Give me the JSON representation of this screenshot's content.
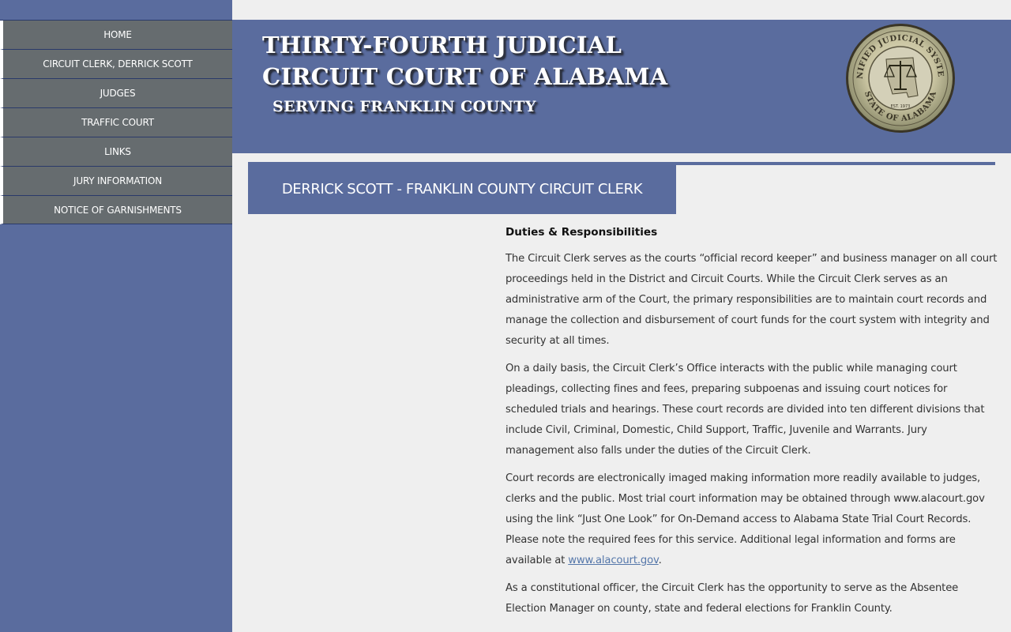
{
  "nav": {
    "items": [
      {
        "label": "HOME"
      },
      {
        "label": "CIRCUIT CLERK, DERRICK SCOTT"
      },
      {
        "label": "JUDGES"
      },
      {
        "label": "TRAFFIC COURT"
      },
      {
        "label": "LINKS"
      },
      {
        "label": "JURY INFORMATION"
      },
      {
        "label": "NOTICE OF GARNISHMENTS"
      }
    ]
  },
  "banner": {
    "line1": "THIRTY-FOURTH JUDICIAL",
    "line2": "CIRCUIT COURT OF ALABAMA",
    "line3": "SERVING FRANKLIN COUNTY",
    "seal": {
      "top_text": "UNIFIED JUDICIAL SYSTEM",
      "bottom_text": "STATE OF ALABAMA",
      "year": "EST. 1973"
    }
  },
  "section": {
    "title": "DERRICK SCOTT - FRANKLIN COUNTY CIRCUIT CLERK"
  },
  "content": {
    "heading": "Duties & Responsibilities",
    "p1": "The Circuit Clerk serves as the courts “official record keeper” and business manager on all court proceedings held in the District and Circuit Courts. While the Circuit Clerk serves as an administrative arm of the Court, the primary responsibilities are to maintain court records and manage the collection and disbursement of court funds for the court system with integrity and security at all times.",
    "p2": "On a daily basis, the Circuit Clerk’s Office interacts with the public while managing court pleadings, collecting fines and fees, preparing subpoenas and issuing court notices for scheduled trials and hearings. These court records are divided into ten different divisions that include Civil, Criminal, Domestic, Child Support, Traffic, Juvenile and Warrants. Jury management also falls under the duties of the Circuit Clerk.",
    "p3": "Court records are electronically imaged making information more readily available to judges, clerks and the public. Most trial court information may be obtained through www.alacourt.gov using the link “Just One Look” for On-Demand access to Alabama State Trial Court Records. Please note the required fees for this service. Additional legal information and forms are available at",
    "p3_link": "www.alacourt.gov",
    "p3_end": ".",
    "p4": "As a constitutional officer, the Circuit Clerk has the opportunity to serve as the Absentee Election Manager on county, state and federal elections for Franklin County."
  },
  "colors": {
    "primary": "#5a6c9e",
    "nav_bg": "#666c6f",
    "page_bg": "#efefef",
    "link": "#5577aa"
  }
}
